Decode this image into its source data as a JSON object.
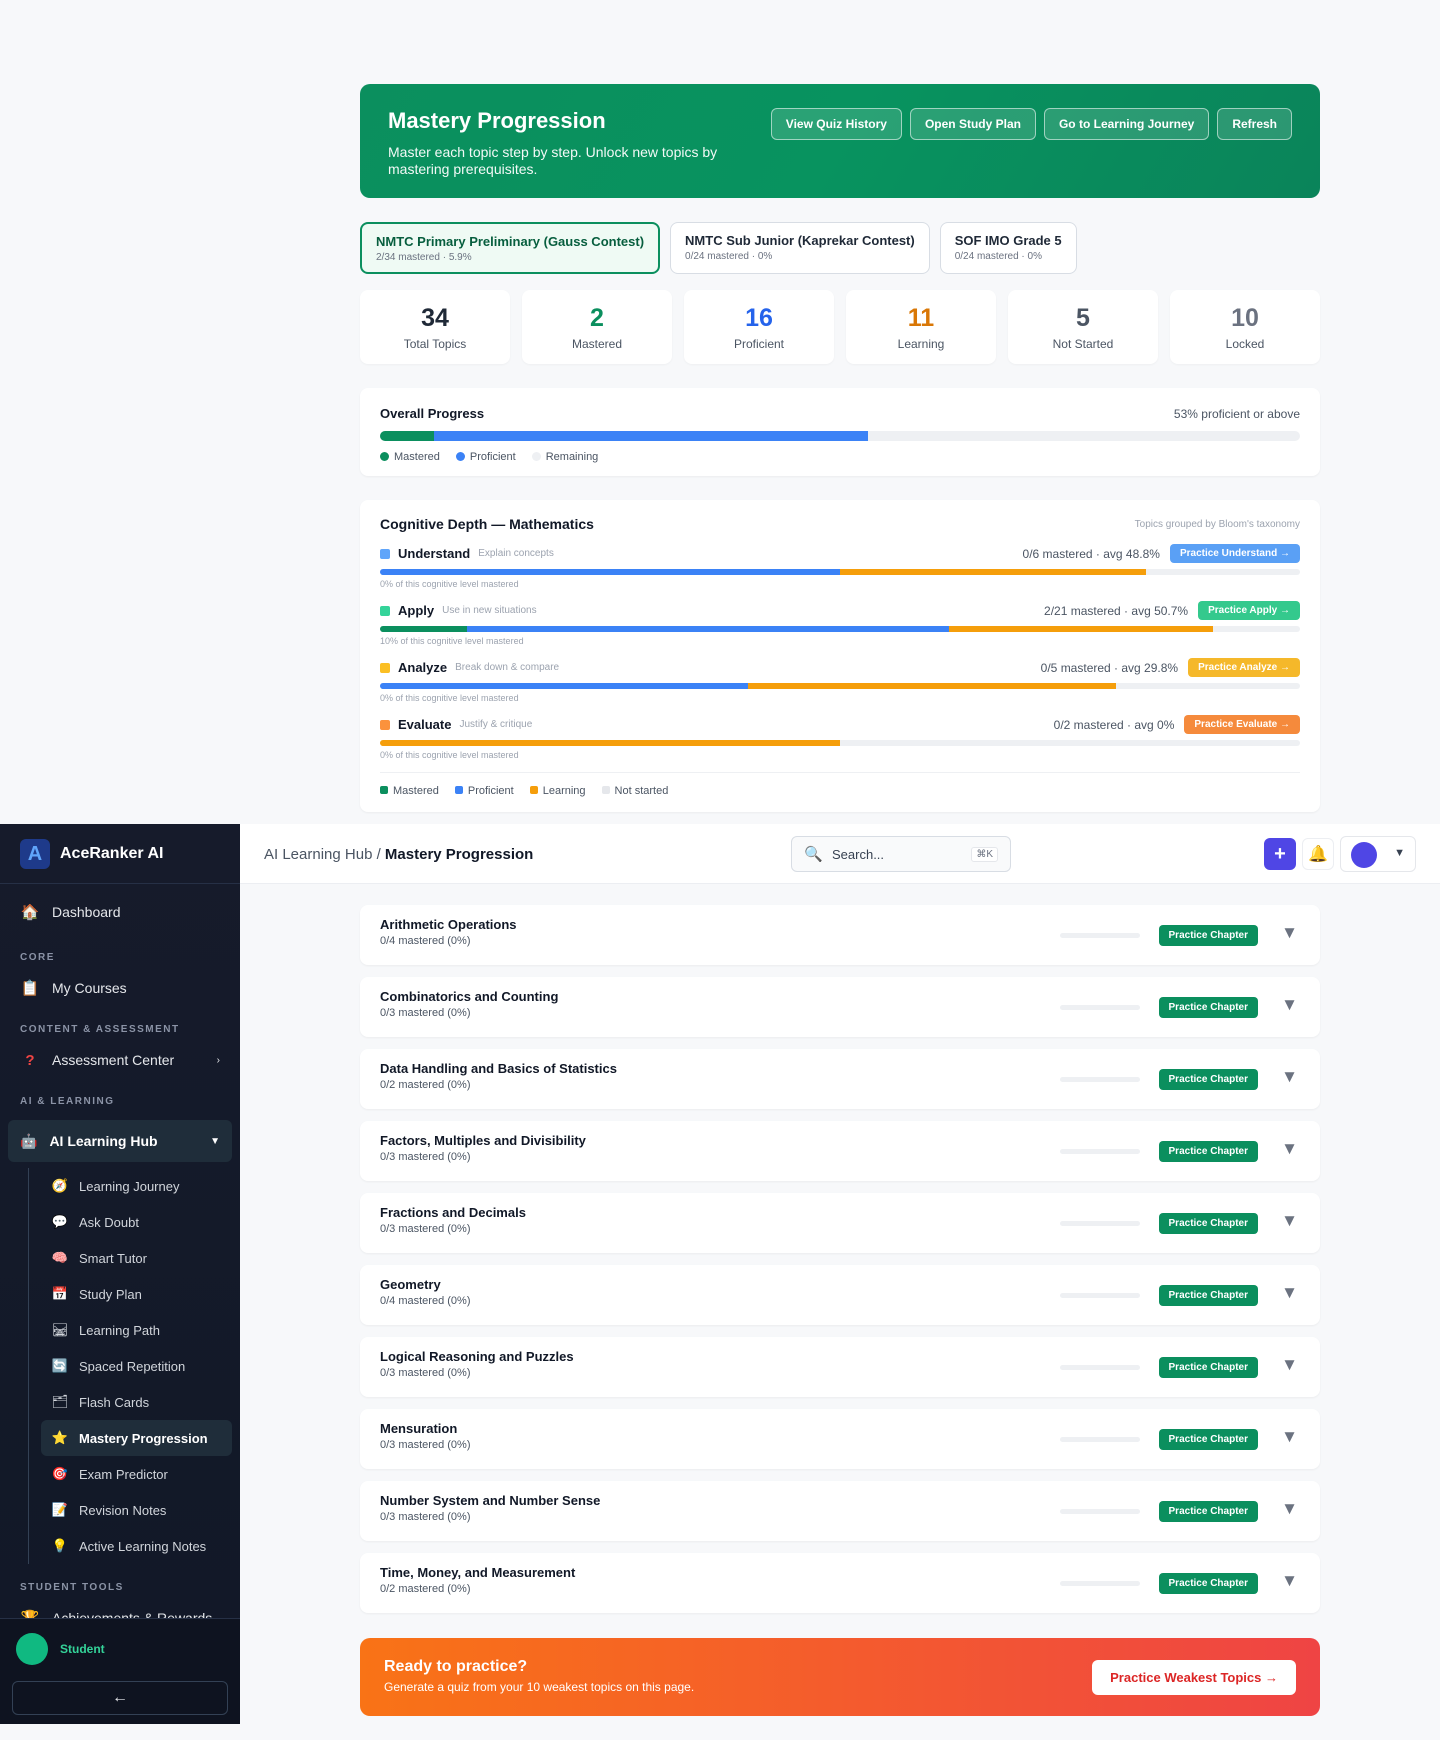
{
  "hero": {
    "title": "Mastery Progression",
    "subtitle": "Master each topic step by step. Unlock new topics by mastering prerequisites.",
    "actions": [
      "View Quiz History",
      "Open Study Plan",
      "Go to Learning Journey",
      "Refresh"
    ]
  },
  "courses": [
    {
      "title": "NMTC Primary Preliminary (Gauss Contest)",
      "stats": "2/34 mastered · 5.9%",
      "active": true
    },
    {
      "title": "NMTC Sub Junior (Kaprekar Contest)",
      "stats": "0/24 mastered · 0%",
      "active": false
    },
    {
      "title": "SOF IMO Grade 5",
      "stats": "0/24 mastered · 0%",
      "active": false
    }
  ],
  "stats": [
    {
      "value": "34",
      "label": "Total Topics",
      "color": "#1f2937"
    },
    {
      "value": "2",
      "label": "Mastered",
      "color": "#0b8f5e"
    },
    {
      "value": "16",
      "label": "Proficient",
      "color": "#2563eb"
    },
    {
      "value": "11",
      "label": "Learning",
      "color": "#d97706"
    },
    {
      "value": "5",
      "label": "Not Started",
      "color": "#4b5563"
    },
    {
      "value": "10",
      "label": "Locked",
      "color": "#6b7280"
    }
  ],
  "overall": {
    "title": "Overall Progress",
    "summary": "53% proficient or above",
    "mastered_pct": 5.9,
    "proficient_pct": 47.1,
    "legend": [
      "Mastered",
      "Proficient",
      "Remaining"
    ]
  },
  "cognitive": {
    "title": "Cognitive Depth — Mathematics",
    "note": "Topics grouped by Bloom's taxonomy",
    "levels": [
      {
        "name": "Understand",
        "sub": "Explain concepts",
        "summary": "0/6 mastered · avg 48.8%",
        "button": "Practice Understand →",
        "color": "#60a5fa",
        "btn_color": "#5aa0f5",
        "footer": "0% of this cognitive level mastered",
        "mastered": 0,
        "proficient": 50,
        "learning": 33.3
      },
      {
        "name": "Apply",
        "sub": "Use in new situations",
        "summary": "2/21 mastered · avg 50.7%",
        "button": "Practice Apply →",
        "color": "#34d399",
        "btn_color": "#34c98d",
        "footer": "10% of this cognitive level mastered",
        "mastered": 9.5,
        "proficient": 52.4,
        "learning": 28.6
      },
      {
        "name": "Analyze",
        "sub": "Break down & compare",
        "summary": "0/5 mastered · avg 29.8%",
        "button": "Practice Analyze →",
        "color": "#fbbf24",
        "btn_color": "#f5b82a",
        "footer": "0% of this cognitive level mastered",
        "mastered": 0,
        "proficient": 40,
        "learning": 40
      },
      {
        "name": "Evaluate",
        "sub": "Justify & critique",
        "summary": "0/2 mastered · avg 0%",
        "button": "Practice Evaluate →",
        "color": "#fb923c",
        "btn_color": "#f58a3c",
        "footer": "0% of this cognitive level mastered",
        "mastered": 0,
        "proficient": 0,
        "learning": 50
      }
    ],
    "legend": [
      "Mastered",
      "Proficient",
      "Learning",
      "Not started"
    ]
  },
  "colors": {
    "mastered": "#0b8f5e",
    "proficient": "#3b82f6",
    "learning": "#f59e0b",
    "remaining": "#e5e7eb"
  },
  "chapters": [
    {
      "name": "Arithmetic Operations",
      "sub": "0/4 mastered (0%)"
    },
    {
      "name": "Combinatorics and Counting",
      "sub": "0/3 mastered (0%)"
    },
    {
      "name": "Data Handling and Basics of Statistics",
      "sub": "0/2 mastered (0%)"
    },
    {
      "name": "Factors, Multiples and Divisibility",
      "sub": "0/3 mastered (0%)"
    },
    {
      "name": "Fractions and Decimals",
      "sub": "0/3 mastered (0%)"
    },
    {
      "name": "Geometry",
      "sub": "0/4 mastered (0%)"
    },
    {
      "name": "Logical Reasoning and Puzzles",
      "sub": "0/3 mastered (0%)"
    },
    {
      "name": "Mensuration",
      "sub": "0/3 mastered (0%)"
    },
    {
      "name": "Number System and Number Sense",
      "sub": "0/3 mastered (0%)"
    },
    {
      "name": "Time, Money, and Measurement",
      "sub": "0/2 mastered (0%)"
    }
  ],
  "chapter_button": "Practice Chapter",
  "cta": {
    "title": "Ready to practice?",
    "subtitle": "Generate a quiz from your 10 weakest topics on this page.",
    "button": "Practice Weakest Topics →"
  },
  "topbar": {
    "crumb_parent": "AI Learning Hub",
    "crumb_sep": "/",
    "crumb_current": "Mastery Progression",
    "search_placeholder": "Search...",
    "shortcut": "⌘K"
  },
  "sidebar": {
    "brand": "AceRanker AI",
    "dashboard": "Dashboard",
    "sections": {
      "core": "CORE",
      "content": "CONTENT & ASSESSMENT",
      "ai": "AI & LEARNING",
      "tools": "STUDENT TOOLS"
    },
    "my_courses": "My Courses",
    "assessment": "Assessment Center",
    "hub": "AI Learning Hub",
    "sub_items": [
      {
        "label": "Learning Journey",
        "icon": "🧭"
      },
      {
        "label": "Ask Doubt",
        "icon": "💬"
      },
      {
        "label": "Smart Tutor",
        "icon": "🧠"
      },
      {
        "label": "Study Plan",
        "icon": "📅"
      },
      {
        "label": "Learning Path",
        "icon": "🛤"
      },
      {
        "label": "Spaced Repetition",
        "icon": "🔄"
      },
      {
        "label": "Flash Cards",
        "icon": "🗂"
      },
      {
        "label": "Mastery Progression",
        "icon": "⭐"
      },
      {
        "label": "Exam Predictor",
        "icon": "🎯"
      },
      {
        "label": "Revision Notes",
        "icon": "📝"
      },
      {
        "label": "Active Learning Notes",
        "icon": "💡"
      }
    ],
    "achievements": "Achievements & Rewards",
    "user": "Student",
    "collapse": "←"
  }
}
